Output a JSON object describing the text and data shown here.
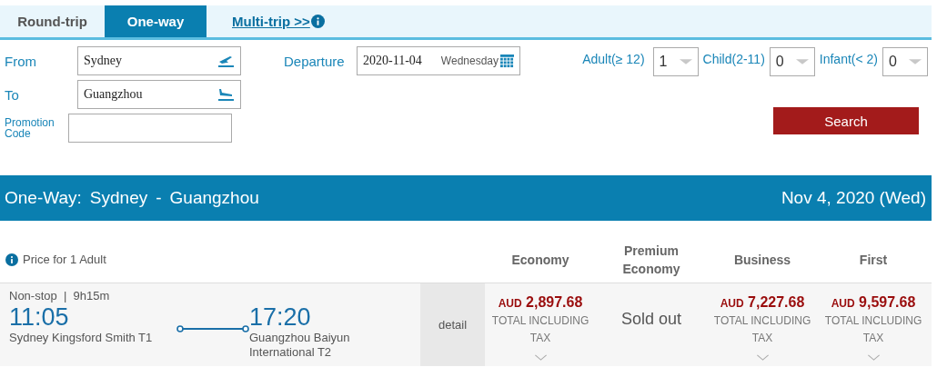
{
  "tabs": [
    {
      "label": "Round-trip",
      "kind": "tab",
      "selected": false
    },
    {
      "label": "One-way",
      "kind": "tab",
      "selected": true
    },
    {
      "label": "Multi-trip >>",
      "kind": "link",
      "selected": false
    }
  ],
  "form": {
    "from": {
      "label": "From",
      "value": "Sydney"
    },
    "to": {
      "label": "To",
      "value": "Guangzhou"
    },
    "promo": {
      "label": "Promotion Code"
    },
    "departure": {
      "label": "Departure",
      "date": "2020-11-04",
      "weekday": "Wednesday"
    },
    "passengers": [
      {
        "label": "Adult(≥ 12)",
        "value": "1"
      },
      {
        "label": "Child(2-11)",
        "value": "0"
      },
      {
        "label": "Infant(< 2)",
        "value": "0"
      }
    ],
    "search_button": "Search"
  },
  "banner": {
    "trip": "One-Way:",
    "origin": "Sydney",
    "separator": "-",
    "destination": "Guangzhou",
    "date": "Nov 4, 2020 (Wed)"
  },
  "price_note": "Price for 1 Adult",
  "cabins": [
    "Economy",
    "Premium Economy",
    "Business",
    "First"
  ],
  "flight": {
    "stops": "Non-stop",
    "separator": "|",
    "duration": "9h15m",
    "depart_time": "11:05",
    "depart_airport": "Sydney Kingsford Smith T1",
    "arrive_time": "17:20",
    "arrive_airport": "Guangzhou Baiyun International T2",
    "detail": "detail",
    "fares": [
      {
        "kind": "price",
        "currency": "AUD",
        "amount": "2,897.68",
        "note": "TOTAL INCLUDING TAX"
      },
      {
        "kind": "soldout",
        "text": "Sold out"
      },
      {
        "kind": "price",
        "currency": "AUD",
        "amount": "7,227.68",
        "note": "TOTAL INCLUDING TAX"
      },
      {
        "kind": "price",
        "currency": "AUD",
        "amount": "9,597.68",
        "note": "TOTAL INCLUDING TAX"
      }
    ]
  }
}
